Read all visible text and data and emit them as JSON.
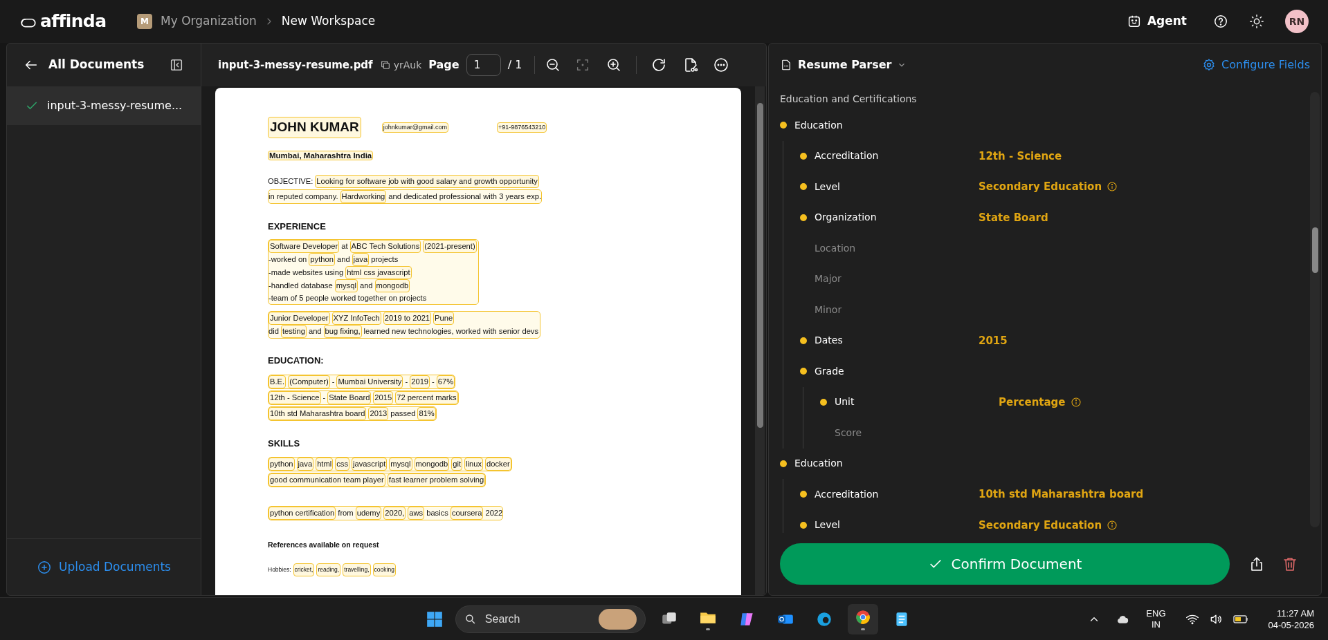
{
  "header": {
    "logo": "affinda",
    "org_initial": "M",
    "breadcrumbs": [
      "My Organization",
      "New Workspace"
    ],
    "agent_label": "Agent",
    "user_initials": "RN"
  },
  "sidebar": {
    "title": "All Documents",
    "documents": [
      {
        "name": "input-3-messy-resume...",
        "selected": true,
        "done": true
      }
    ],
    "upload_label": "Upload Documents"
  },
  "viewer": {
    "file_name": "input-3-messy-resume.pdf",
    "doc_id": "yrAuk",
    "page_label": "Page",
    "page_value": "1",
    "page_total": "/ 1"
  },
  "resume": {
    "name": "JOHN KUMAR",
    "email": "johnkumar@gmail.com",
    "phone": "+91-9876543210",
    "location": "Mumbai, Maharashtra India",
    "blocks": [
      {
        "kind": "text",
        "boxed": false,
        "lines": [
          {
            "boxed": false,
            "segments": [
              {
                "text": "OBJECTIVE:",
                "tagged": false
              },
              {
                "text": "Looking for software job with good salary and growth opportunity",
                "tagged": true
              }
            ]
          },
          {
            "boxed": true,
            "segments": [
              {
                "text": "in reputed company.",
                "tagged": false
              },
              {
                "text": "Hardworking",
                "tagged": true
              },
              {
                "text": "and dedicated professional with 3 years exp.",
                "tagged": false
              }
            ]
          }
        ]
      },
      {
        "kind": "heading",
        "text": "EXPERIENCE"
      },
      {
        "kind": "text",
        "boxed": true,
        "lines": [
          {
            "boxed": false,
            "segments": [
              {
                "text": "Software Developer",
                "tagged": true
              },
              {
                "text": "at",
                "tagged": false
              },
              {
                "text": "ABC Tech Solutions",
                "tagged": true
              },
              {
                "text": "(2021-present)",
                "tagged": true
              }
            ]
          },
          {
            "boxed": false,
            "segments": [
              {
                "text": "-worked on",
                "tagged": false
              },
              {
                "text": "python",
                "tagged": true
              },
              {
                "text": "and",
                "tagged": false
              },
              {
                "text": "java",
                "tagged": true
              },
              {
                "text": "projects",
                "tagged": false
              }
            ]
          },
          {
            "boxed": false,
            "segments": [
              {
                "text": "-made websites using",
                "tagged": false
              },
              {
                "text": "html css javascript",
                "tagged": true
              }
            ]
          },
          {
            "boxed": false,
            "segments": [
              {
                "text": "-handled database",
                "tagged": false
              },
              {
                "text": "mysql",
                "tagged": true
              },
              {
                "text": "and",
                "tagged": false
              },
              {
                "text": "mongodb",
                "tagged": true
              }
            ]
          },
          {
            "boxed": false,
            "segments": [
              {
                "text": "-team of 5 people worked together on projects",
                "tagged": false
              }
            ]
          }
        ]
      },
      {
        "kind": "text",
        "boxed": true,
        "lines": [
          {
            "boxed": false,
            "segments": [
              {
                "text": "Junior Developer",
                "tagged": true
              },
              {
                "text": "XYZ InfoTech",
                "tagged": true
              },
              {
                "text": "2019 to 2021",
                "tagged": true
              },
              {
                "text": "Pune",
                "tagged": true
              }
            ]
          },
          {
            "boxed": false,
            "segments": [
              {
                "text": "did",
                "tagged": false
              },
              {
                "text": "testing",
                "tagged": true
              },
              {
                "text": "and",
                "tagged": false
              },
              {
                "text": "bug fixing,",
                "tagged": true
              },
              {
                "text": "learned new technologies, worked with senior devs",
                "tagged": false
              }
            ]
          }
        ]
      },
      {
        "kind": "heading",
        "text": "EDUCATION:"
      },
      {
        "kind": "text",
        "boxed": false,
        "lines": [
          {
            "boxed": true,
            "segments": [
              {
                "text": "B.E.",
                "tagged": true
              },
              {
                "text": "(Computer)",
                "tagged": true
              },
              {
                "text": "-",
                "tagged": false
              },
              {
                "text": "Mumbai University",
                "tagged": true
              },
              {
                "text": "-",
                "tagged": false
              },
              {
                "text": "2019",
                "tagged": true
              },
              {
                "text": "-",
                "tagged": false
              },
              {
                "text": "67%",
                "tagged": true
              }
            ]
          },
          {
            "boxed": true,
            "segments": [
              {
                "text": "12th - Science",
                "tagged": true
              },
              {
                "text": "-",
                "tagged": false
              },
              {
                "text": "State Board",
                "tagged": true
              },
              {
                "text": "2015",
                "tagged": true
              },
              {
                "text": "72 percent marks",
                "tagged": true
              }
            ]
          },
          {
            "boxed": true,
            "segments": [
              {
                "text": "10th std Maharashtra board",
                "tagged": true
              },
              {
                "text": "2013",
                "tagged": true
              },
              {
                "text": "passed",
                "tagged": false
              },
              {
                "text": "81%",
                "tagged": true
              }
            ]
          }
        ]
      },
      {
        "kind": "heading",
        "text": "SKILLS"
      },
      {
        "kind": "text",
        "boxed": false,
        "lines": [
          {
            "boxed": true,
            "segments": [
              {
                "text": "python",
                "tagged": true
              },
              {
                "text": "java",
                "tagged": true
              },
              {
                "text": "html",
                "tagged": true
              },
              {
                "text": "css",
                "tagged": true
              },
              {
                "text": "javascript",
                "tagged": true
              },
              {
                "text": "mysql",
                "tagged": true
              },
              {
                "text": "mongodb",
                "tagged": true
              },
              {
                "text": "git",
                "tagged": true
              },
              {
                "text": "linux",
                "tagged": true
              },
              {
                "text": "docker",
                "tagged": true
              }
            ]
          },
          {
            "boxed": true,
            "segments": [
              {
                "text": "good communication team player",
                "tagged": true
              },
              {
                "text": "fast learner problem solving",
                "tagged": true
              }
            ]
          }
        ]
      },
      {
        "kind": "spaced",
        "boxed": false,
        "lines": [
          {
            "boxed": true,
            "segments": [
              {
                "text": "python certification",
                "tagged": true
              },
              {
                "text": "from",
                "tagged": false
              },
              {
                "text": "udemy",
                "tagged": true
              },
              {
                "text": "2020,",
                "tagged": true
              },
              {
                "text": "aws",
                "tagged": true
              },
              {
                "text": "basics",
                "tagged": false
              },
              {
                "text": "coursera",
                "tagged": true
              },
              {
                "text": "2022",
                "tagged": false
              }
            ]
          }
        ]
      },
      {
        "kind": "note",
        "text": "References available on request"
      },
      {
        "kind": "small",
        "boxed": false,
        "lines": [
          {
            "boxed": false,
            "segments": [
              {
                "text": "Hobbies:",
                "tagged": false
              },
              {
                "text": "cricket,",
                "tagged": true
              },
              {
                "text": "reading,",
                "tagged": true
              },
              {
                "text": "travelling,",
                "tagged": true
              },
              {
                "text": "cooking",
                "tagged": true
              }
            ]
          }
        ]
      }
    ]
  },
  "parser": {
    "title": "Resume Parser",
    "configure_label": "Configure Fields",
    "section_title": "Education and Certifications",
    "fields": [
      {
        "label": "Education",
        "filled": true,
        "info": false,
        "children": [
          {
            "label": "Accreditation",
            "value": "12th - Science",
            "filled": true,
            "info": false
          },
          {
            "label": "Level",
            "value": "Secondary Education",
            "filled": true,
            "info": true
          },
          {
            "label": "Organization",
            "value": "State Board",
            "filled": true,
            "info": false
          },
          {
            "label": "Location",
            "filled": false,
            "info": false
          },
          {
            "label": "Major",
            "filled": false,
            "info": false
          },
          {
            "label": "Minor",
            "filled": false,
            "info": false
          },
          {
            "label": "Dates",
            "value": "2015",
            "filled": true,
            "info": false
          },
          {
            "label": "Grade",
            "filled": true,
            "info": false,
            "children": [
              {
                "label": "Unit",
                "value": "Percentage",
                "filled": true,
                "info": true
              },
              {
                "label": "Score",
                "filled": false,
                "info": false
              }
            ]
          }
        ]
      },
      {
        "label": "Education",
        "filled": true,
        "info": false,
        "children": [
          {
            "label": "Accreditation",
            "value": "10th std Maharashtra board",
            "filled": true,
            "info": false
          },
          {
            "label": "Level",
            "value": "Secondary Education",
            "filled": true,
            "info": true
          }
        ]
      }
    ],
    "confirm_label": "Confirm Document"
  },
  "taskbar": {
    "search_placeholder": "Search",
    "language": "ENG",
    "region": "IN",
    "time": "11:27 AM",
    "date": "04-05-2026"
  }
}
